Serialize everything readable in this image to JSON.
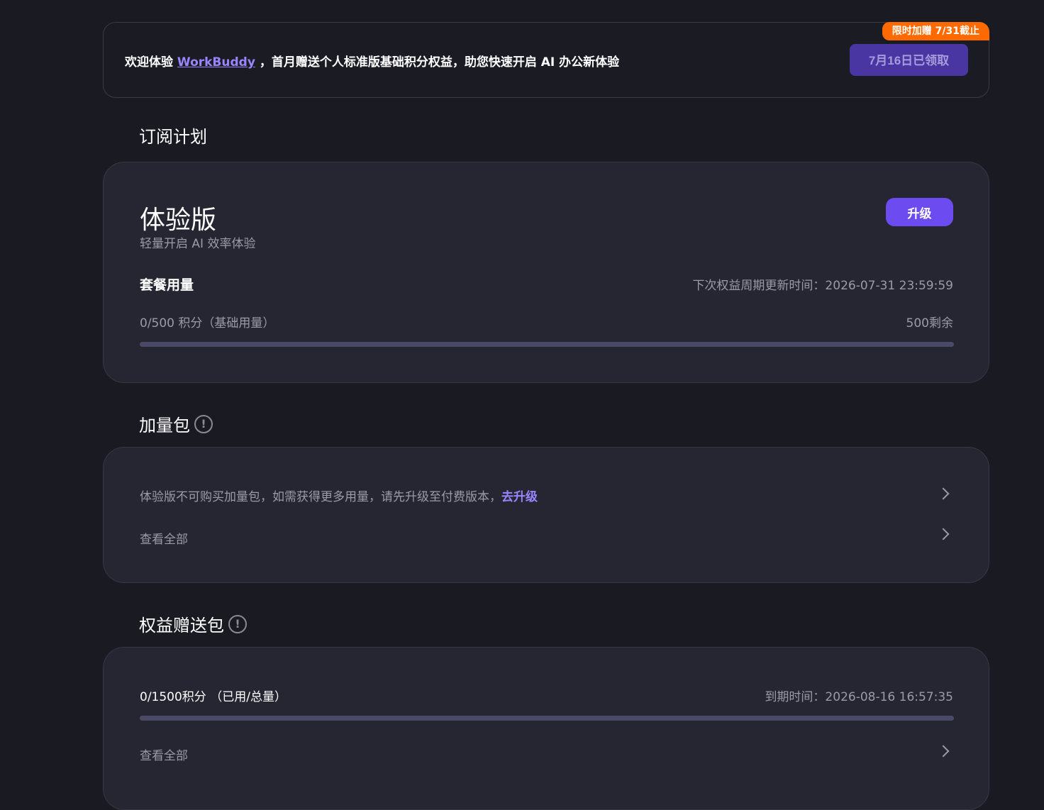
{
  "banner": {
    "text_prefix": "欢迎体验 ",
    "brand_link": "WorkBuddy",
    "text_suffix": " ，首月赠送个人标准版基础积分权益，助您快速开启 AI 办公新体验",
    "promo_badge": "限时加赠 7/31截止",
    "claimed_button": "7月16日已领取"
  },
  "subscription": {
    "section_title": "订阅计划",
    "plan_name": "体验版",
    "plan_desc": "轻量开启 AI 效率体验",
    "upgrade_button": "升级",
    "usage_title": "套餐用量",
    "renew_time": "下次权益周期更新时间：2026-07-31 23:59:59",
    "usage_amount": "0/500 积分（基础用量）",
    "usage_remaining": "500剩余",
    "usage_progress": 0
  },
  "addon": {
    "section_title": "加量包",
    "notice_text": "体验版不可购买加量包，如需获得更多用量，请先升级至付费版本，",
    "upgrade_link": "去升级",
    "view_all": "查看全部"
  },
  "gift": {
    "section_title": "权益赠送包",
    "amount": "0/1500积分 （已用/总量）",
    "expire_time": "到期时间：2026-08-16 16:57:35",
    "progress": 0,
    "view_all": "查看全部"
  },
  "colors": {
    "background": "#1a1a23",
    "card": "#262633",
    "accent": "#6c4cf0",
    "link": "#9a85ff",
    "promo": "#ff6a00"
  }
}
